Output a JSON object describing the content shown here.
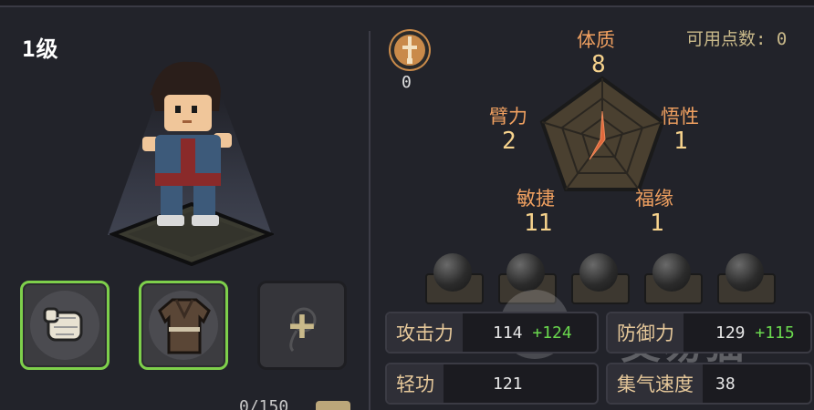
{
  "level": {
    "text": "1级"
  },
  "equipment": {
    "slot1": {
      "name": "gloves-icon",
      "equipped": true
    },
    "slot2": {
      "name": "robe-icon",
      "equipped": true
    },
    "slot3": {
      "name": "add-slot",
      "equipped": false,
      "label": "+"
    }
  },
  "experience": {
    "text": "0/150"
  },
  "sword_stat": {
    "value": "0",
    "icon": "sword-emblem-icon"
  },
  "available_points": {
    "label": "可用点数:",
    "value": "0"
  },
  "attributes": {
    "constitution": {
      "name": "体质",
      "value": "8"
    },
    "comprehension": {
      "name": "悟性",
      "value": "1"
    },
    "fortune": {
      "name": "福缘",
      "value": "1"
    },
    "agility": {
      "name": "敏捷",
      "value": "11"
    },
    "arm_strength": {
      "name": "臂力",
      "value": "2"
    }
  },
  "stats": {
    "attack": {
      "label": "攻击力",
      "value": "114",
      "bonus": "+124"
    },
    "defense": {
      "label": "防御力",
      "value": "129",
      "bonus": "+115"
    },
    "qinggong": {
      "label": "轻功",
      "value": "121"
    },
    "qi_speed": {
      "label": "集气速度",
      "value": "38"
    }
  },
  "watermark": {
    "text": "交易猫"
  },
  "colors": {
    "equipped_border": "#7ed04b",
    "bonus": "#6ad84e",
    "attr_name": "#f0a060",
    "attr_value": "#f6d28c"
  }
}
